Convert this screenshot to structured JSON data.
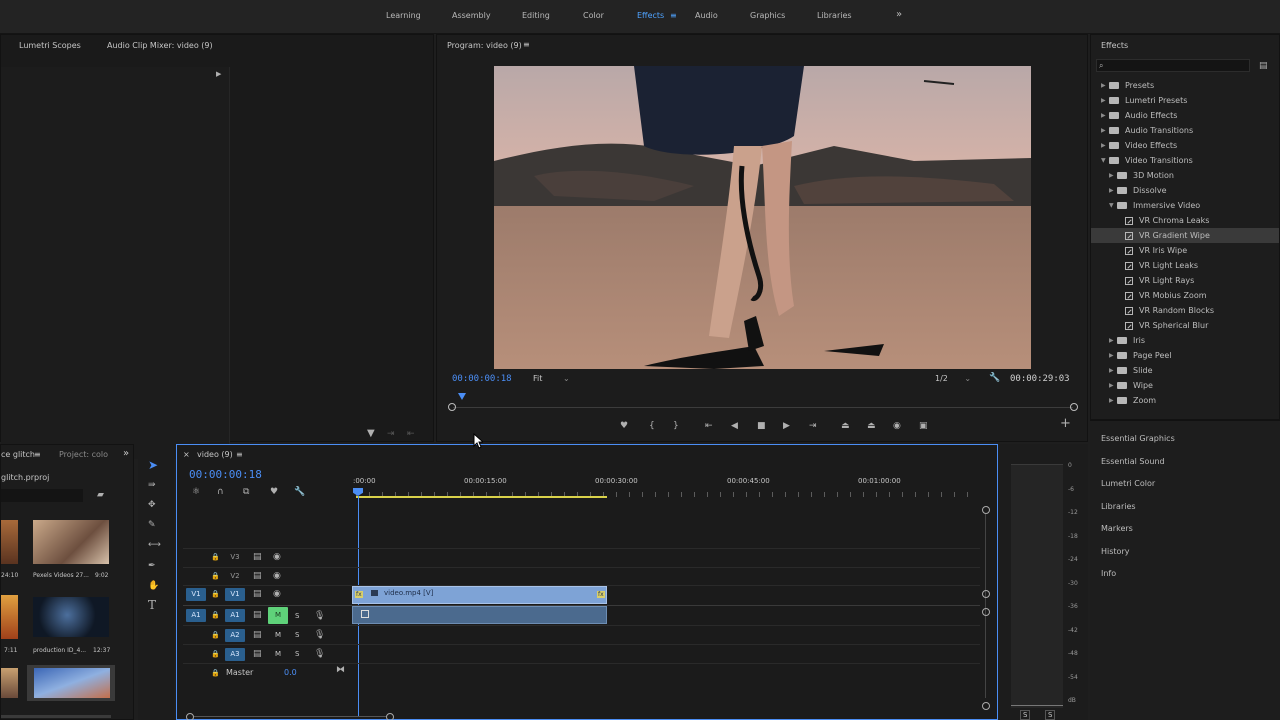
{
  "workspaces": {
    "tabs": [
      "Learning",
      "Assembly",
      "Editing",
      "Color",
      "Effects",
      "Audio",
      "Graphics",
      "Libraries"
    ],
    "active": "Effects",
    "more": "»",
    "menu_icon": "≡"
  },
  "source_panel": {
    "tab1": "Lumetri Scopes",
    "tab2": "Audio Clip Mixer: video (9)"
  },
  "program": {
    "title": "Program: video (9)",
    "timecode": "00:00:00:18",
    "fit": "Fit",
    "resolution": "1/2",
    "duration": "00:00:29:03"
  },
  "effects": {
    "title": "Effects",
    "items": [
      {
        "label": "Presets",
        "level": 0,
        "type": "folder",
        "expanded": false
      },
      {
        "label": "Lumetri Presets",
        "level": 0,
        "type": "folder",
        "expanded": false
      },
      {
        "label": "Audio Effects",
        "level": 0,
        "type": "folder",
        "expanded": false
      },
      {
        "label": "Audio Transitions",
        "level": 0,
        "type": "folder",
        "expanded": false
      },
      {
        "label": "Video Effects",
        "level": 0,
        "type": "folder",
        "expanded": false
      },
      {
        "label": "Video Transitions",
        "level": 0,
        "type": "folder",
        "expanded": true
      },
      {
        "label": "3D Motion",
        "level": 1,
        "type": "folder",
        "expanded": false
      },
      {
        "label": "Dissolve",
        "level": 1,
        "type": "folder",
        "expanded": false
      },
      {
        "label": "Immersive Video",
        "level": 1,
        "type": "folder",
        "expanded": true
      },
      {
        "label": "VR Chroma Leaks",
        "level": 2,
        "type": "effect"
      },
      {
        "label": "VR Gradient Wipe",
        "level": 2,
        "type": "effect",
        "selected": true
      },
      {
        "label": "VR Iris Wipe",
        "level": 2,
        "type": "effect"
      },
      {
        "label": "VR Light Leaks",
        "level": 2,
        "type": "effect"
      },
      {
        "label": "VR Light Rays",
        "level": 2,
        "type": "effect"
      },
      {
        "label": "VR Mobius Zoom",
        "level": 2,
        "type": "effect"
      },
      {
        "label": "VR Random Blocks",
        "level": 2,
        "type": "effect"
      },
      {
        "label": "VR Spherical Blur",
        "level": 2,
        "type": "effect"
      },
      {
        "label": "Iris",
        "level": 1,
        "type": "folder",
        "expanded": false
      },
      {
        "label": "Page Peel",
        "level": 1,
        "type": "folder",
        "expanded": false
      },
      {
        "label": "Slide",
        "level": 1,
        "type": "folder",
        "expanded": false
      },
      {
        "label": "Wipe",
        "level": 1,
        "type": "folder",
        "expanded": false
      },
      {
        "label": "Zoom",
        "level": 1,
        "type": "folder",
        "expanded": false
      }
    ]
  },
  "side_panels": [
    "Essential Graphics",
    "Essential Sound",
    "Lumetri Color",
    "Libraries",
    "Markers",
    "History",
    "Info"
  ],
  "project": {
    "tab1": "ce glitch",
    "tab2": "Project: colo",
    "file": "glitch.prproj",
    "clips": [
      {
        "name": "",
        "duration": "24:10"
      },
      {
        "name": "Pexels Videos 27...",
        "duration": "9:02"
      },
      {
        "name": "",
        "duration": "7:11"
      },
      {
        "name": "production ID_4...",
        "duration": "12:37"
      }
    ]
  },
  "timeline": {
    "tab": "video (9)",
    "timecode": "00:00:00:18",
    "ruler": [
      ":00:00",
      "00:00:15:00",
      "00:00:30:00",
      "00:00:45:00",
      "00:01:00:00"
    ],
    "tracks": {
      "v3": "V3",
      "v2": "V2",
      "v1": "V1",
      "a1": "A1",
      "a2": "A2",
      "a3": "A3",
      "src_v1": "V1",
      "src_a1": "A1",
      "m": "M",
      "s": "S",
      "master": "Master",
      "master_value": "0.0"
    },
    "clip_label": "video.mp4 [V]",
    "fx_badge": "fx"
  },
  "meters": {
    "scale": [
      "0",
      "-6",
      "-12",
      "-18",
      "-24",
      "-30",
      "-36",
      "-42",
      "-48",
      "-54",
      "dB"
    ],
    "solo": "S"
  },
  "colors": {
    "accent": "#4b8ef5",
    "clip_video": "#7ea3d6",
    "clip_audio": "#4b6a8e",
    "mute_active": "#5fd27a"
  }
}
